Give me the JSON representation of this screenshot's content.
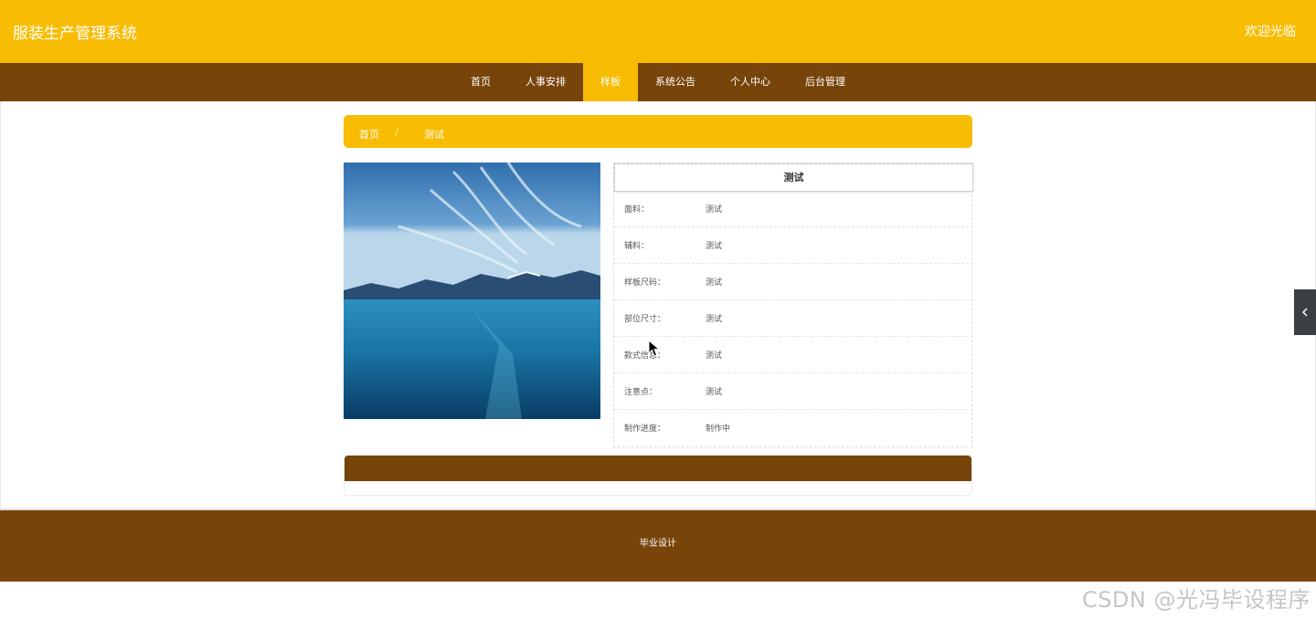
{
  "header": {
    "site_title": "服装生产管理系统",
    "welcome": "欢迎光临"
  },
  "nav": {
    "items": [
      {
        "label": "首页",
        "active": false
      },
      {
        "label": "人事安排",
        "active": false
      },
      {
        "label": "样板",
        "active": true
      },
      {
        "label": "系统公告",
        "active": false
      },
      {
        "label": "个人中心",
        "active": false
      },
      {
        "label": "后台管理",
        "active": false
      }
    ]
  },
  "breadcrumb": {
    "home": "首页",
    "separator": "/",
    "current": "测试"
  },
  "detail": {
    "title": "测试",
    "rows": [
      {
        "label": "面料：",
        "value": "测试"
      },
      {
        "label": "辅料：",
        "value": "测试"
      },
      {
        "label": "样板尺码：",
        "value": "测试"
      },
      {
        "label": "部位尺寸：",
        "value": "测试"
      },
      {
        "label": "款式信息：",
        "value": "测试"
      },
      {
        "label": "注意点：",
        "value": "测试"
      },
      {
        "label": "制作进度：",
        "value": "制作中"
      }
    ]
  },
  "footer": {
    "text": "毕业设计"
  },
  "watermark": "CSDN @光冯毕设程序",
  "colors": {
    "header_yellow": "#f8bc02",
    "nav_brown": "#77440a"
  },
  "icons": {
    "side_toggle": "chevron-left-icon",
    "cursor": "mouse-pointer-icon"
  }
}
